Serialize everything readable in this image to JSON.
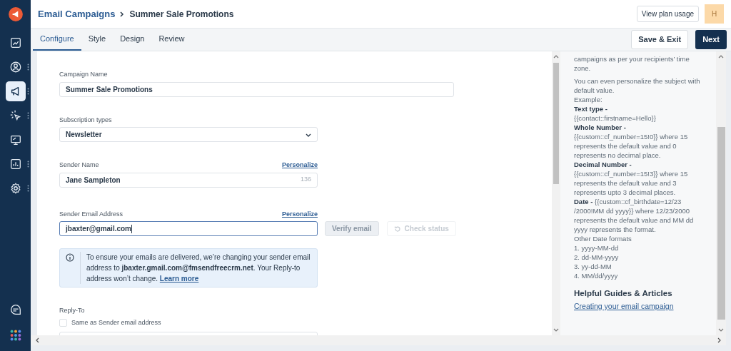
{
  "sidebar": {
    "items": [
      {
        "kind": "logo",
        "selected": false,
        "menu": false
      },
      {
        "kind": "dashboard",
        "selected": false,
        "menu": false
      },
      {
        "kind": "contacts",
        "selected": false,
        "menu": true
      },
      {
        "kind": "megaphone",
        "selected": true,
        "menu": true
      },
      {
        "kind": "sparkle",
        "selected": false,
        "menu": true
      },
      {
        "kind": "monitor",
        "selected": false,
        "menu": false
      },
      {
        "kind": "chart",
        "selected": false,
        "menu": true
      },
      {
        "kind": "gear",
        "selected": false,
        "menu": true
      }
    ],
    "bottom": [
      {
        "kind": "chat"
      },
      {
        "kind": "apps"
      }
    ]
  },
  "header": {
    "breadcrumb": [
      "Email Campaigns",
      "Summer Sale Promotions"
    ],
    "plan_button": "View plan usage",
    "avatar": "H"
  },
  "tabs": [
    {
      "label": "Configure",
      "selected": true
    },
    {
      "label": "Style",
      "selected": false
    },
    {
      "label": "Design",
      "selected": false
    },
    {
      "label": "Review",
      "selected": false
    }
  ],
  "actions": {
    "save": "Save & Exit",
    "next": "Next"
  },
  "form": {
    "campaign_name": {
      "label": "Campaign Name",
      "value": "Summer Sale Promotions"
    },
    "subscription": {
      "label": "Subscription types",
      "value": "Newsletter"
    },
    "sender_name": {
      "label": "Sender Name",
      "link": "Personalize",
      "value": "Jane Sampleton",
      "counter": "136"
    },
    "sender_email": {
      "label": "Sender Email Address",
      "link": "Personalize",
      "value": "jbaxter@gmail.com",
      "verify": "Verify email",
      "check": "Check status"
    },
    "notice": {
      "text": "To ensure your emails are delivered, we’re changing your sender email address to **jbaxter.gmail.com@fmsendfreecrm.net**. Your Reply-to address won’t change.",
      "link": "Learn more"
    },
    "reply_to": {
      "label": "Reply-To",
      "checkbox": "Same as Sender email address",
      "checked": false
    }
  },
  "help": {
    "lines": [
      {
        "kind": "paragraph",
        "text": "campaigns as per your recipients’ time zone."
      },
      {
        "kind": "text",
        "text": "You can even personalize the subject with default value."
      },
      {
        "kind": "text",
        "text": "Example:"
      },
      {
        "kind": "term",
        "text": "Text type -"
      },
      {
        "kind": "text",
        "text": "{{contact::firstname=Hello}}"
      },
      {
        "kind": "term",
        "text": "Whole Number -"
      },
      {
        "kind": "text",
        "text": "{{custom::cf_number=15!0}} where 15 represents the default value and 0 represents no decimal place."
      },
      {
        "kind": "term",
        "text": "Decimal Number -"
      },
      {
        "kind": "text",
        "text": "{{custom::cf_number=15!3}} where 15 represents the default value and 3 represents upto 3 decimal places."
      },
      {
        "kind": "text",
        "text": "**Date -** {{custom::cf_birthdate=12/23 /2000!MM dd yyyy}} where 12/23/2000 represents the default value and MM dd yyyy represents the format."
      },
      {
        "kind": "text",
        "text": "Other Date formats"
      },
      {
        "kind": "text",
        "text": "1. yyyy-MM-dd"
      },
      {
        "kind": "text",
        "text": "2. dd-MM-yyyy"
      },
      {
        "kind": "text",
        "text": "3. yy-dd-MM"
      },
      {
        "kind": "text",
        "text": "4. MM/dd/yyyy"
      }
    ],
    "guides_title": "Helpful Guides & Articles",
    "guides": [
      "Creating your email campaign"
    ]
  }
}
